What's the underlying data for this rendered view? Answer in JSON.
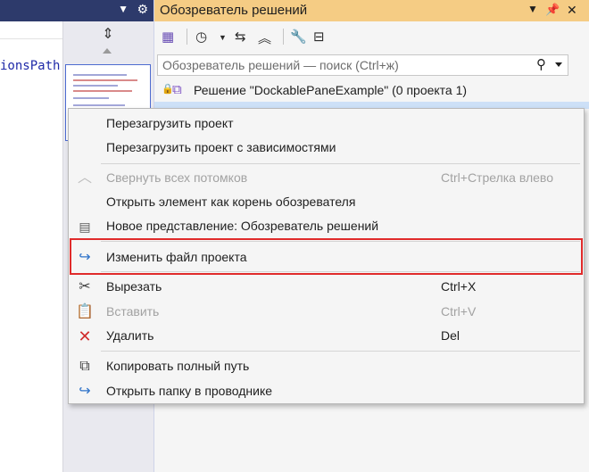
{
  "editor": {
    "code_fragment": "ionsPath"
  },
  "solution_explorer": {
    "title": "Обозреватель решений",
    "search_placeholder": "Обозреватель решений — поиск (Ctrl+ж)",
    "solution_label": "Решение \"DockablePaneExample\"  (0 проекта 1)"
  },
  "context_menu": {
    "items": [
      {
        "label": "Перезагрузить проект",
        "shortcut": "",
        "icon": "",
        "enabled": true
      },
      {
        "label": "Перезагрузить проект с зависимостями",
        "shortcut": "",
        "icon": "",
        "enabled": true
      },
      {
        "label": "Свернуть всех потомков",
        "shortcut": "Ctrl+Стрелка влево",
        "icon": "collapse-chevron-icon",
        "enabled": false
      },
      {
        "label": "Открыть элемент как корень обозревателя",
        "shortcut": "",
        "icon": "",
        "enabled": true
      },
      {
        "label": "Новое представление: Обозреватель решений",
        "shortcut": "",
        "icon": "new-view-icon",
        "enabled": true
      },
      {
        "label": "Изменить файл проекта",
        "shortcut": "",
        "icon": "redo-arrow-icon",
        "enabled": true
      },
      {
        "label": "Вырезать",
        "shortcut": "Ctrl+X",
        "icon": "scissors-icon",
        "enabled": true
      },
      {
        "label": "Вставить",
        "shortcut": "Ctrl+V",
        "icon": "paste-icon",
        "enabled": false
      },
      {
        "label": "Удалить",
        "shortcut": "Del",
        "icon": "delete-x-icon",
        "enabled": true
      },
      {
        "label": "Копировать полный путь",
        "shortcut": "",
        "icon": "copy-icon",
        "enabled": true
      },
      {
        "label": "Открыть папку в проводнике",
        "shortcut": "",
        "icon": "redo-arrow-icon",
        "enabled": true
      }
    ]
  },
  "colors": {
    "title_bar_active": "#f5cc84",
    "left_header": "#2d3a6b",
    "highlight_border": "#e02b2b",
    "icon_blue": "#2f73c9",
    "icon_red": "#d12d2d"
  }
}
